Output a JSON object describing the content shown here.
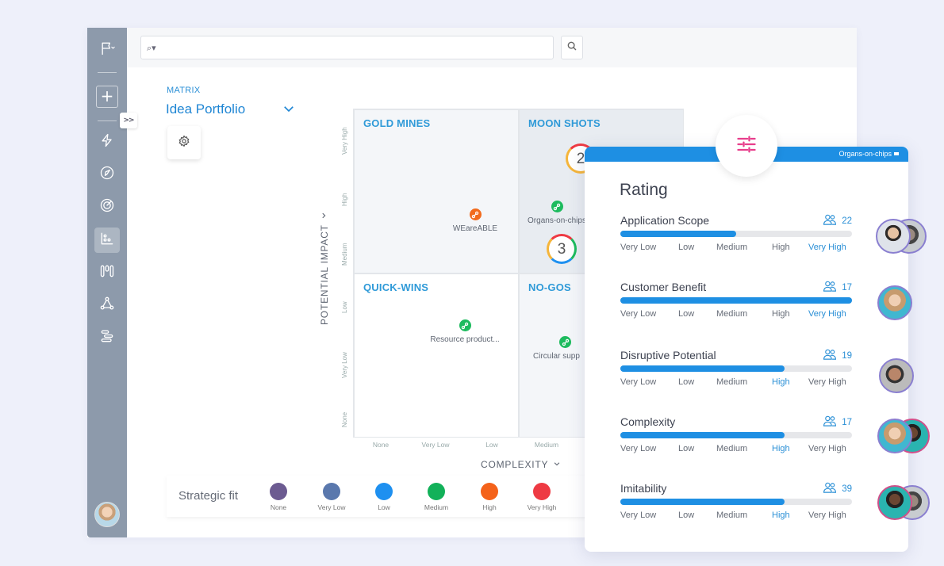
{
  "sidebar": {
    "items": [
      {
        "name": "flag",
        "label": "Flag menu"
      },
      {
        "name": "lightning",
        "label": "Activity"
      },
      {
        "name": "navigation",
        "label": "Explore"
      },
      {
        "name": "radar",
        "label": "Radar"
      },
      {
        "name": "matrix-chart",
        "label": "Matrix",
        "active": true
      },
      {
        "name": "kanban",
        "label": "Board"
      },
      {
        "name": "network",
        "label": "Network"
      },
      {
        "name": "roadmap",
        "label": "Roadmap"
      }
    ],
    "add_label": "+",
    "expand_label": ">>"
  },
  "search": {
    "placeholder": "",
    "value": ""
  },
  "matrix": {
    "section_label": "MATRIX",
    "title": "Idea Portfolio",
    "quadrants": {
      "gold": "GOLD MINES",
      "moon": "MOON SHOTS",
      "quick": "QUICK-WINS",
      "nogo": "NO-GOS"
    },
    "ideas": [
      {
        "label": "WEareABLE",
        "color": "#f26b1d"
      },
      {
        "label": "Organs-on-chips",
        "color": "#1dbb5e"
      },
      {
        "label": "Resource product...",
        "color": "#1dbb5e"
      },
      {
        "label": "Circular supp",
        "color": "#1dbb5e"
      }
    ],
    "clusters": [
      {
        "count": "2"
      },
      {
        "count": "3"
      }
    ],
    "y_axis": {
      "title": "POTENTIAL IMPACT",
      "ticks": [
        "Very High",
        "High",
        "Medium",
        "Low",
        "Very Low",
        "None"
      ]
    },
    "x_axis": {
      "title": "COMPLEXITY",
      "ticks": [
        "None",
        "Very Low",
        "Low",
        "Medium"
      ]
    }
  },
  "legend": {
    "title": "Strategic fit",
    "items": [
      {
        "label": "None",
        "color": "#6c5b91"
      },
      {
        "label": "Very Low",
        "color": "#5a78ad"
      },
      {
        "label": "Low",
        "color": "#1e90f0"
      },
      {
        "label": "Medium",
        "color": "#12b159"
      },
      {
        "label": "High",
        "color": "#f4621a"
      },
      {
        "label": "Very High",
        "color": "#ee3a43"
      }
    ]
  },
  "rating": {
    "tag": "Organs-on-chips",
    "title": "Rating",
    "scale": [
      "Very Low",
      "Low",
      "Medium",
      "High",
      "Very High"
    ],
    "criteria": [
      {
        "name": "Application Scope",
        "count": "22",
        "fill_percent": 50,
        "selected": "Very High"
      },
      {
        "name": "Customer Benefit",
        "count": "17",
        "fill_percent": 100,
        "selected": "Very High"
      },
      {
        "name": "Disruptive Potential",
        "count": "19",
        "fill_percent": 71,
        "selected": "High"
      },
      {
        "name": "Complexity",
        "count": "17",
        "fill_percent": 71,
        "selected": "High"
      },
      {
        "name": "Imitability",
        "count": "39",
        "fill_percent": 71,
        "selected": "High"
      }
    ]
  },
  "colors": {
    "accent": "#1e8fe3",
    "sidebar": "#8d9aab",
    "rating_icon": "#e83e8c"
  }
}
